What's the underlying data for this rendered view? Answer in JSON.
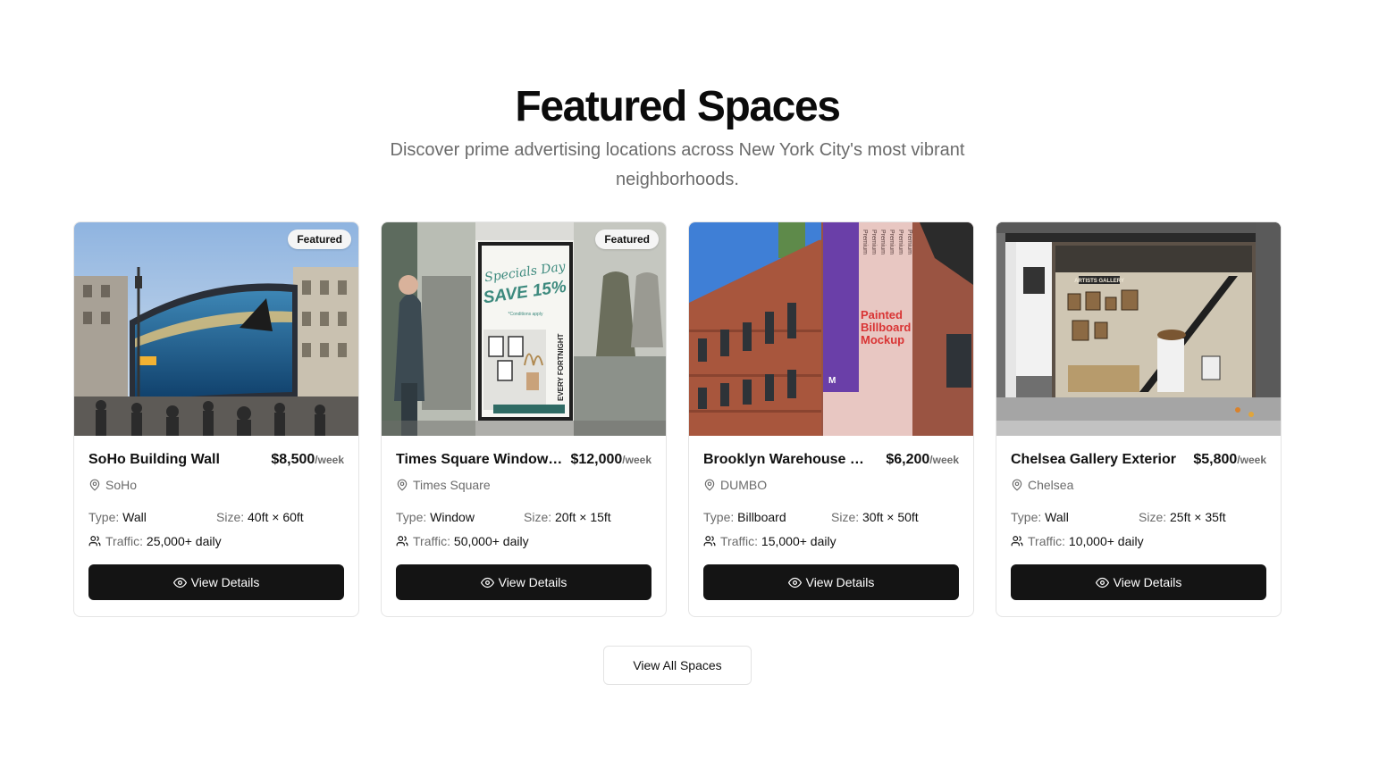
{
  "header": {
    "title": "Featured Spaces",
    "subtitle": "Discover prime advertising locations across New York City's most vibrant neighborhoods."
  },
  "labels": {
    "type": "Type:",
    "size": "Size:",
    "traffic": "Traffic:",
    "per_week": "/week",
    "view_details": "View Details",
    "featured": "Featured"
  },
  "cards": [
    {
      "name": "SoHo Building Wall",
      "price": "$8,500",
      "location": "SoHo",
      "type": "Wall",
      "size": "40ft × 60ft",
      "traffic": "25,000+ daily",
      "featured": true
    },
    {
      "name": "Times Square Window…",
      "price": "$12,000",
      "location": "Times Square",
      "type": "Window",
      "size": "20ft × 15ft",
      "traffic": "50,000+ daily",
      "featured": true,
      "image_text": {
        "script": "Specials Day",
        "save": "SAVE 15%",
        "fine": "*Conditions apply",
        "vertical": "EVERY FORTNIGHT"
      }
    },
    {
      "name": "Brooklyn Warehouse Si…",
      "price": "$6,200",
      "location": "DUMBO",
      "type": "Billboard",
      "size": "30ft × 50ft",
      "traffic": "15,000+ daily",
      "featured": false,
      "image_text": {
        "mockup": [
          "Painted",
          "Billboard",
          "Mockup"
        ],
        "premium": "Premium",
        "mark": "M"
      }
    },
    {
      "name": "Chelsea Gallery Exterior",
      "price": "$5,800",
      "location": "Chelsea",
      "type": "Wall",
      "size": "25ft × 35ft",
      "traffic": "10,000+ daily",
      "featured": false,
      "image_text": {
        "sign": "ARTISTS GALLERY"
      }
    }
  ],
  "footer": {
    "view_all": "View All Spaces"
  },
  "icons": {
    "location": "map-pin-icon",
    "traffic": "users-icon",
    "view": "eye-icon"
  },
  "colors": {
    "button_bg": "#141414",
    "muted_text": "#6b6b6b",
    "border": "#e5e5e5"
  }
}
